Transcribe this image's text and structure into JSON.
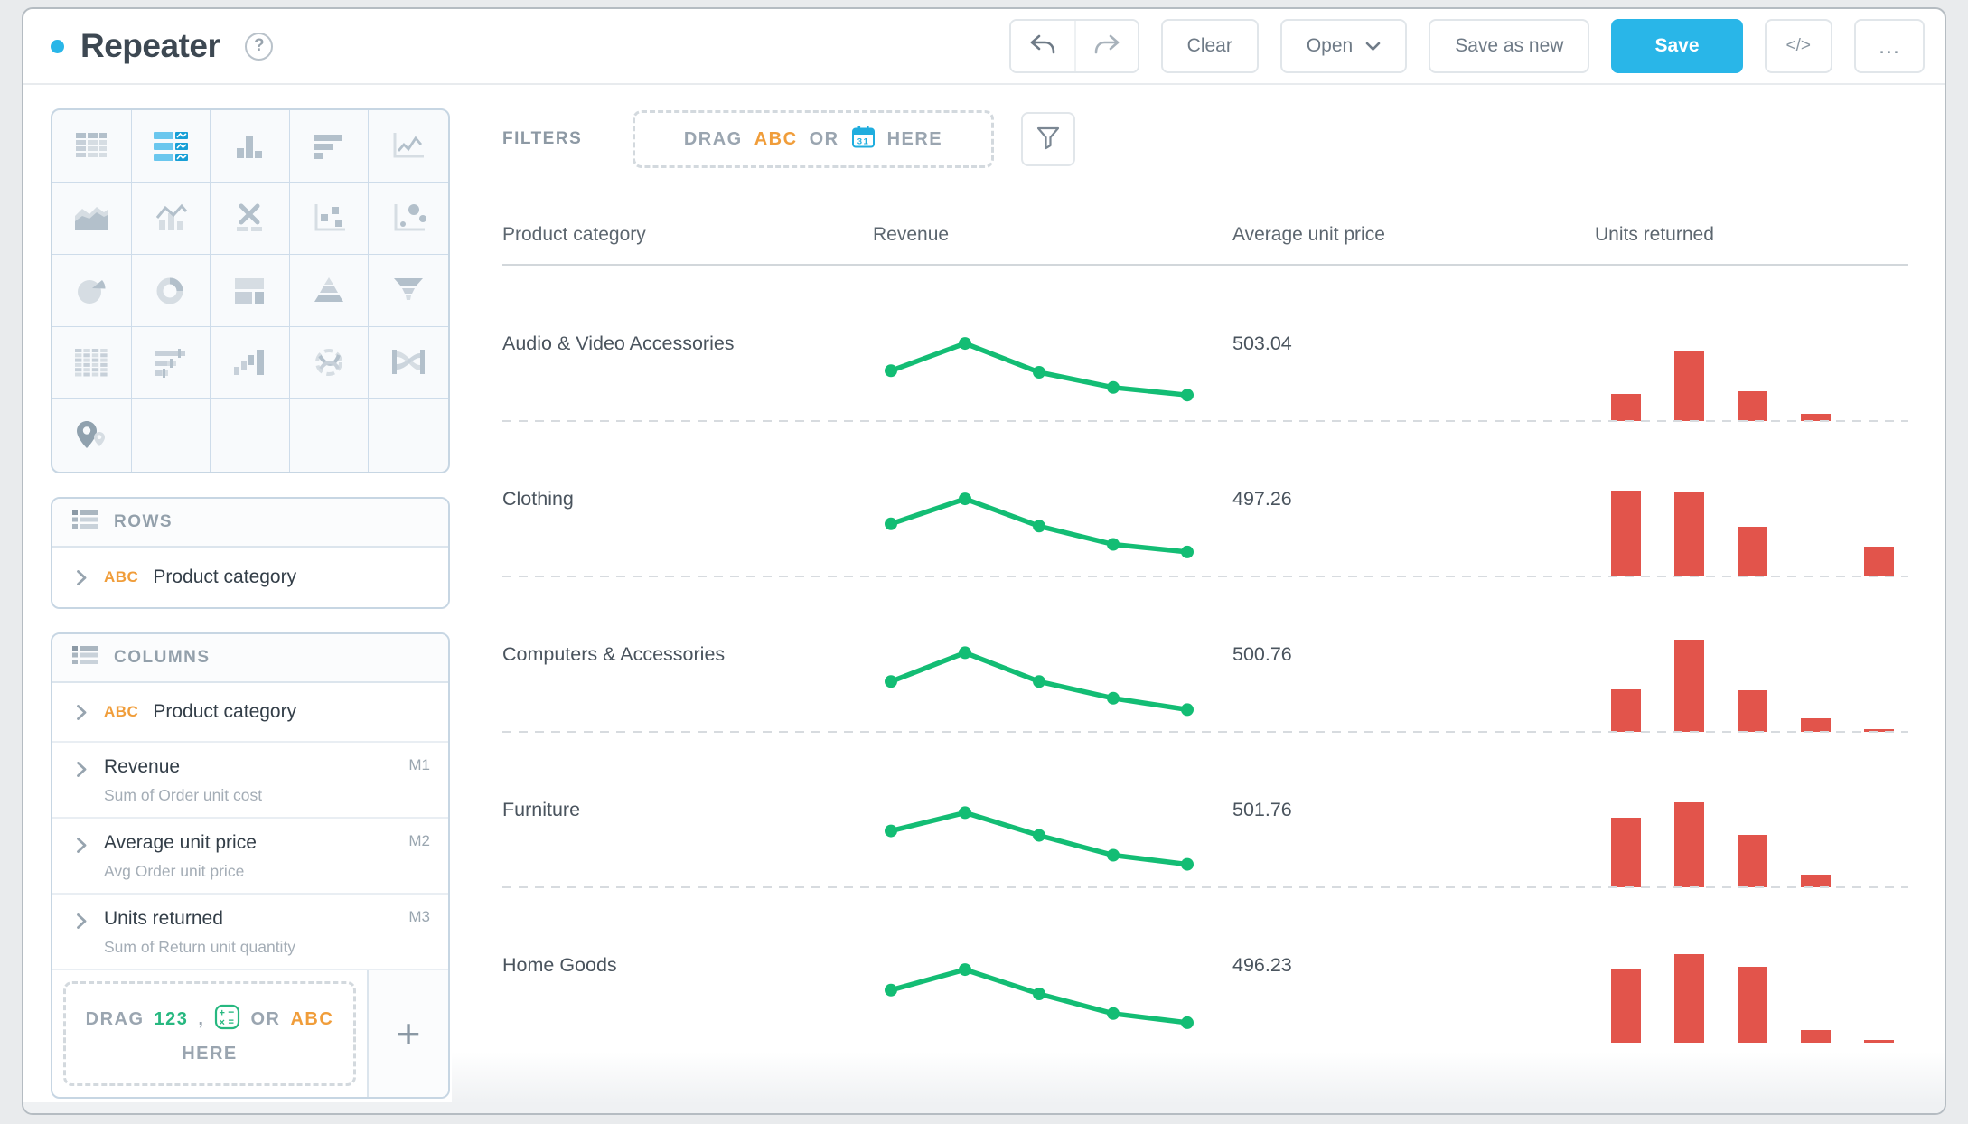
{
  "colors": {
    "accent_blue": "#29b6e8",
    "sparkline_green": "#13bd74",
    "bar_red": "#e2544b",
    "tag_orange": "#f09d3a",
    "tag_green": "#27b880"
  },
  "topbar": {
    "title": "Repeater",
    "help": "?",
    "clear": "Clear",
    "open": "Open",
    "save_as_new": "Save as new",
    "save": "Save",
    "code": "</>",
    "more": "…"
  },
  "chart_picker": {
    "selected": "repeater",
    "icons": [
      "table",
      "repeater",
      "bar-chart",
      "horizontal-bar-chart",
      "line-chart",
      "area-chart",
      "combo-chart",
      "crosstab",
      "scatter-plot",
      "bubble-chart",
      "pie-chart",
      "donut-chart",
      "treemap",
      "pyramid",
      "funnel",
      "pivot-table",
      "bullet-chart",
      "waterfall",
      "chord-diagram",
      "sankey",
      "map",
      "",
      "",
      "",
      ""
    ]
  },
  "rows_panel": {
    "title": "ROWS",
    "items": [
      {
        "type_tag": "ABC",
        "label": "Product category"
      }
    ]
  },
  "columns_panel": {
    "title": "COLUMNS",
    "items": [
      {
        "type_tag": "ABC",
        "label": "Product category"
      },
      {
        "label": "Revenue",
        "sublabel": "Sum of Order unit cost",
        "badge": "M1"
      },
      {
        "label": "Average unit price",
        "sublabel": "Avg Order unit price",
        "badge": "M2"
      },
      {
        "label": "Units returned",
        "sublabel": "Sum of Return unit quantity",
        "badge": "M3"
      }
    ],
    "drop_zone": {
      "drag": "DRAG",
      "num_tag": "123",
      "comma": ",",
      "or": "OR",
      "abc_tag": "ABC",
      "here": "HERE"
    },
    "add_button": "+"
  },
  "filters_bar": {
    "label": "FILTERS",
    "drop_zone": {
      "drag": "DRAG",
      "abc_tag": "ABC",
      "or": "OR",
      "calendar_day": "31",
      "here": "HERE"
    }
  },
  "table": {
    "headers": [
      "Product category",
      "Revenue",
      "Average unit price",
      "Units returned"
    ],
    "rows": [
      {
        "category": "Audio & Video Accessories",
        "avg_unit_price": "503.04",
        "revenue_trend": [
          0.52,
          0.88,
          0.5,
          0.3,
          0.2
        ],
        "units_returned_bars": [
          29,
          75,
          32,
          8,
          0
        ]
      },
      {
        "category": "Clothing",
        "avg_unit_price": "497.26",
        "revenue_trend": [
          0.55,
          0.88,
          0.52,
          0.28,
          0.18
        ],
        "units_returned_bars": [
          93,
          91,
          54,
          0,
          32
        ]
      },
      {
        "category": "Computers & Accessories",
        "avg_unit_price": "500.76",
        "revenue_trend": [
          0.52,
          0.9,
          0.52,
          0.3,
          0.15
        ],
        "units_returned_bars": [
          46,
          100,
          45,
          15,
          2
        ]
      },
      {
        "category": "Furniture",
        "avg_unit_price": "501.76",
        "revenue_trend": [
          0.6,
          0.84,
          0.54,
          0.28,
          0.16
        ],
        "units_returned_bars": [
          75,
          92,
          57,
          14,
          0
        ]
      },
      {
        "category": "Home Goods",
        "avg_unit_price": "496.23",
        "revenue_trend": [
          0.55,
          0.82,
          0.5,
          0.24,
          0.12
        ],
        "units_returned_bars": [
          80,
          96,
          82,
          14,
          3
        ]
      }
    ]
  },
  "chart_data": {
    "type": "table",
    "columns": [
      "Product category",
      "Revenue trend (normalized line)",
      "Average unit price",
      "Units returned (relative bars)"
    ],
    "rows": [
      [
        "Audio & Video Accessories",
        [
          0.52,
          0.88,
          0.5,
          0.3,
          0.2
        ],
        503.04,
        [
          29,
          75,
          32,
          8,
          0
        ]
      ],
      [
        "Clothing",
        [
          0.55,
          0.88,
          0.52,
          0.28,
          0.18
        ],
        497.26,
        [
          93,
          91,
          54,
          0,
          32
        ]
      ],
      [
        "Computers & Accessories",
        [
          0.52,
          0.9,
          0.52,
          0.3,
          0.15
        ],
        500.76,
        [
          46,
          100,
          45,
          15,
          2
        ]
      ],
      [
        "Furniture",
        [
          0.6,
          0.84,
          0.54,
          0.28,
          0.16
        ],
        501.76,
        [
          75,
          92,
          57,
          14,
          0
        ]
      ],
      [
        "Home Goods",
        [
          0.55,
          0.82,
          0.5,
          0.24,
          0.12
        ],
        496.23,
        [
          80,
          96,
          82,
          14,
          3
        ]
      ]
    ]
  }
}
